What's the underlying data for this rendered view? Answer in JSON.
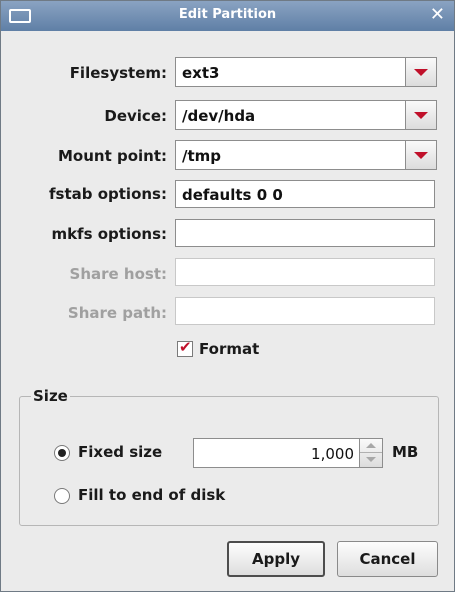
{
  "window": {
    "title": "Edit Partition"
  },
  "form": {
    "filesystem": {
      "label": "Filesystem:",
      "value": "ext3"
    },
    "device": {
      "label": "Device:",
      "value": "/dev/hda"
    },
    "mount_point": {
      "label": "Mount point:",
      "value": "/tmp"
    },
    "fstab_options": {
      "label": "fstab options:",
      "value": "defaults 0 0"
    },
    "mkfs_options": {
      "label": "mkfs options:",
      "value": ""
    },
    "share_host": {
      "label": "Share host:",
      "value": ""
    },
    "share_path": {
      "label": "Share path:",
      "value": ""
    },
    "format": {
      "label": "Format",
      "checked": true
    }
  },
  "size": {
    "title": "Size",
    "fixed_size": {
      "label": "Fixed size",
      "selected": true,
      "value": "1,000",
      "unit": "MB"
    },
    "fill_to_end": {
      "label": "Fill to end of disk",
      "selected": false
    }
  },
  "buttons": {
    "apply": "Apply",
    "cancel": "Cancel"
  },
  "colors": {
    "titlebar": "#6f8db3",
    "arrow": "#c0102a",
    "background": "#ebebeb"
  },
  "icons": [
    "window-menu-icon",
    "close-icon",
    "dropdown-arrow-icon",
    "checkmark-icon",
    "spinner-up-icon",
    "spinner-down-icon"
  ]
}
